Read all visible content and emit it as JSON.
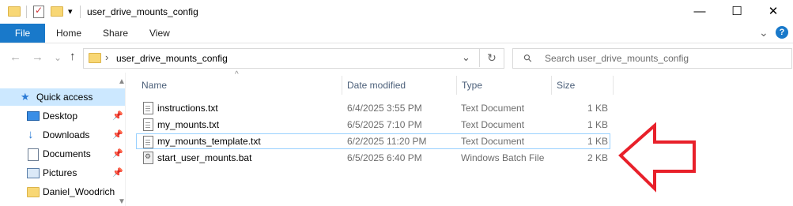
{
  "window": {
    "title": "user_drive_mounts_config",
    "minimize_glyph": "—",
    "maximize_glyph": "☐",
    "close_glyph": "✕",
    "qa_dropdown_glyph": "▾"
  },
  "ribbon": {
    "tabs": [
      "File",
      "Home",
      "Share",
      "View"
    ],
    "collapse_glyph": "⌄",
    "help_glyph": "?"
  },
  "nav": {
    "back_glyph": "←",
    "forward_glyph": "→",
    "recent_glyph": "⌄",
    "up_glyph": "↑",
    "breadcrumb_separator": "›",
    "breadcrumb_folder": "user_drive_mounts_config",
    "address_dropdown_glyph": "⌄",
    "refresh_glyph": "↻",
    "search_placeholder": "Search user_drive_mounts_config",
    "search_glyph": "⚲"
  },
  "sidebar": {
    "items": [
      {
        "label": "Quick access",
        "icon": "star-icon",
        "pinned": false
      },
      {
        "label": "Desktop",
        "icon": "desktop-icon",
        "pinned": true
      },
      {
        "label": "Downloads",
        "icon": "download-arrow-icon",
        "pinned": true
      },
      {
        "label": "Documents",
        "icon": "documents-icon",
        "pinned": true
      },
      {
        "label": "Pictures",
        "icon": "pictures-icon",
        "pinned": true
      },
      {
        "label": "Daniel_Woodrich",
        "icon": "folder-icon",
        "pinned": false
      }
    ],
    "pin_glyph": "📌",
    "scroll_up_glyph": "▲",
    "scroll_down_glyph": "▼"
  },
  "columns": {
    "name": "Name",
    "date": "Date modified",
    "type": "Type",
    "size": "Size",
    "sort_glyph": "^"
  },
  "files": [
    {
      "name": "instructions.txt",
      "date": "6/4/2025 3:55 PM",
      "type": "Text Document",
      "size": "1 KB",
      "icon": "text-file-icon"
    },
    {
      "name": "my_mounts.txt",
      "date": "6/5/2025 7:10 PM",
      "type": "Text Document",
      "size": "1 KB",
      "icon": "text-file-icon"
    },
    {
      "name": "my_mounts_template.txt",
      "date": "6/2/2025 11:20 PM",
      "type": "Text Document",
      "size": "1 KB",
      "icon": "text-file-icon"
    },
    {
      "name": "start_user_mounts.bat",
      "date": "6/5/2025 6:40 PM",
      "type": "Windows Batch File",
      "size": "2 KB",
      "icon": "batch-file-icon"
    }
  ],
  "annotation": {
    "color": "#e8202a",
    "shape": "arrow-pointing-left"
  },
  "colors": {
    "file_tab": "#1979ca",
    "selection": "#cce8ff",
    "focus_border": "#99d1ff",
    "header_text": "#4c607a"
  }
}
